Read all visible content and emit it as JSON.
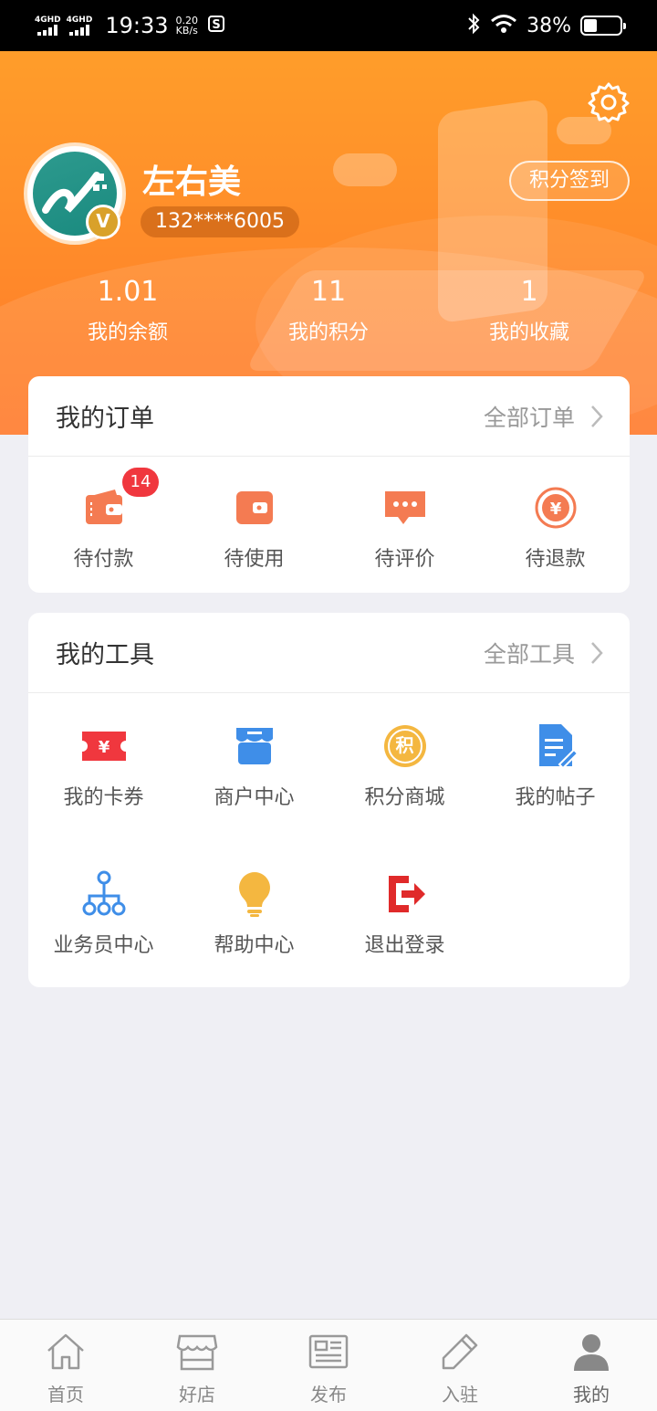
{
  "status_bar": {
    "network1": "4GHD",
    "network2": "4GHD",
    "time": "19:33",
    "speed_value": "0.20",
    "speed_unit": "KB/s",
    "battery_percent": "38%",
    "battery_level": 0.38
  },
  "profile": {
    "name": "左右美",
    "phone": "132****6005",
    "vip_badge": "V",
    "signin_label": "积分签到"
  },
  "stats": [
    {
      "value": "1.01",
      "label": "我的余额"
    },
    {
      "value": "11",
      "label": "我的积分"
    },
    {
      "value": "1",
      "label": "我的收藏"
    }
  ],
  "orders": {
    "title": "我的订单",
    "more": "全部订单",
    "items": [
      {
        "label": "待付款",
        "icon": "wallet-icon",
        "badge": "14"
      },
      {
        "label": "待使用",
        "icon": "card-icon"
      },
      {
        "label": "待评价",
        "icon": "comment-icon"
      },
      {
        "label": "待退款",
        "icon": "refund-icon"
      }
    ]
  },
  "tools": {
    "title": "我的工具",
    "more": "全部工具",
    "items": [
      {
        "label": "我的卡券",
        "icon": "coupon-icon"
      },
      {
        "label": "商户中心",
        "icon": "store-icon"
      },
      {
        "label": "积分商城",
        "icon": "points-icon",
        "glyph": "积"
      },
      {
        "label": "我的帖子",
        "icon": "post-icon"
      },
      {
        "label": "业务员中心",
        "icon": "org-icon"
      },
      {
        "label": "帮助中心",
        "icon": "bulb-icon"
      },
      {
        "label": "退出登录",
        "icon": "logout-icon"
      }
    ]
  },
  "tabbar": [
    {
      "label": "首页",
      "icon": "home-icon"
    },
    {
      "label": "好店",
      "icon": "shop-icon"
    },
    {
      "label": "发布",
      "icon": "publish-icon"
    },
    {
      "label": "入驻",
      "icon": "pencil-icon"
    },
    {
      "label": "我的",
      "icon": "user-icon",
      "active": true
    }
  ],
  "colors": {
    "accent": "#ff8a2a",
    "order_icon": "#f47b52",
    "badge": "#f0373e",
    "blue_icon": "#3f8ee8",
    "yellow_icon": "#f4b740",
    "red_icon": "#e02a2a"
  }
}
